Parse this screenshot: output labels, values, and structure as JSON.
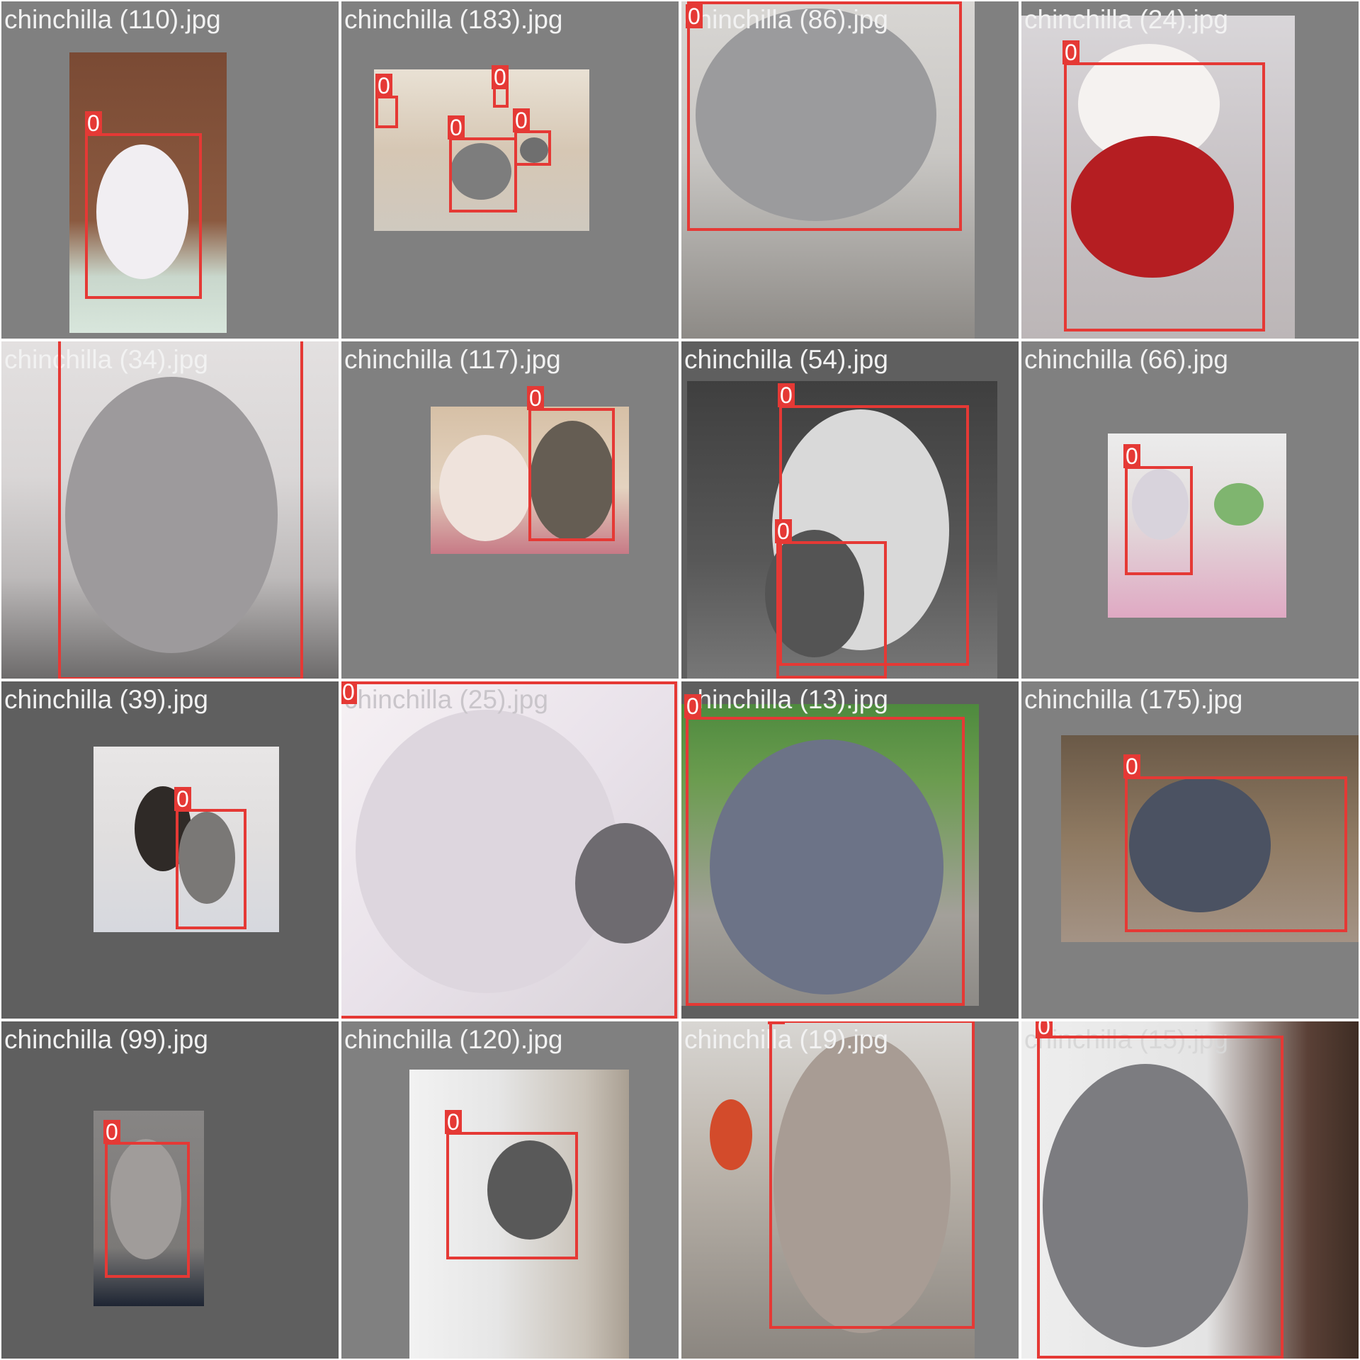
{
  "class_label": "0",
  "tiles": [
    {
      "filename": "chinchilla (110).jpg"
    },
    {
      "filename": "chinchilla (183).jpg"
    },
    {
      "filename": "chinchilla (86).jpg"
    },
    {
      "filename": "chinchilla (24).jpg"
    },
    {
      "filename": "chinchilla (34).jpg"
    },
    {
      "filename": "chinchilla (117).jpg"
    },
    {
      "filename": "chinchilla (54).jpg"
    },
    {
      "filename": "chinchilla (66).jpg"
    },
    {
      "filename": "chinchilla (39).jpg"
    },
    {
      "filename": "chinchilla (25).jpg"
    },
    {
      "filename": "chinchilla (13).jpg"
    },
    {
      "filename": "chinchilla (175).jpg"
    },
    {
      "filename": "chinchilla (99).jpg"
    },
    {
      "filename": "chinchilla (120).jpg"
    },
    {
      "filename": "chinchilla (19).jpg"
    },
    {
      "filename": "chinchilla (15).jpg"
    }
  ]
}
